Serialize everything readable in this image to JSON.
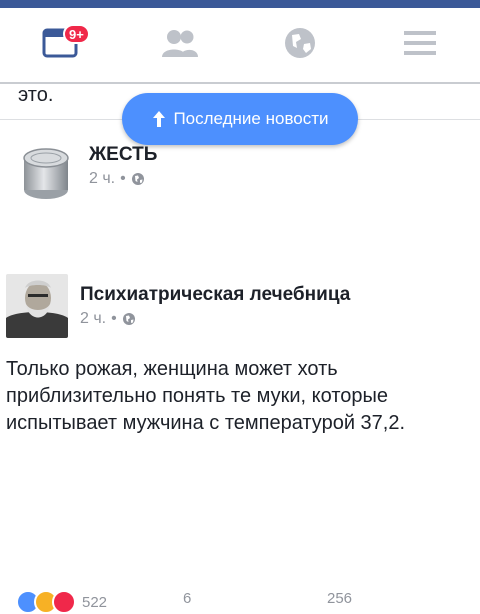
{
  "nav": {
    "notifications_badge": "9+",
    "items": [
      "news-feed",
      "friends",
      "notifications",
      "menu"
    ]
  },
  "previous_post_tail": "это.",
  "new_posts_button": "Последние новости",
  "posts": [
    {
      "page_name": "ЖЕСТЬ",
      "time": "2 ч.",
      "separator": "•",
      "privacy_icon": "globe-icon"
    },
    {
      "page_name": "Психиатрическая лечебница",
      "time": "2 ч.",
      "separator": "•",
      "privacy_icon": "globe-icon",
      "text": "Только рожая, женщина может хоть приблизительно понять те муки, которые испытывает мужчина с температурой 37,2."
    }
  ],
  "footer": {
    "reactions_count": "522",
    "comments_count": "6",
    "shares_count": "256"
  },
  "colors": {
    "brand": "#3b5998",
    "accent": "#4d90fe",
    "badge": "#f02849",
    "muted": "#90949c"
  }
}
